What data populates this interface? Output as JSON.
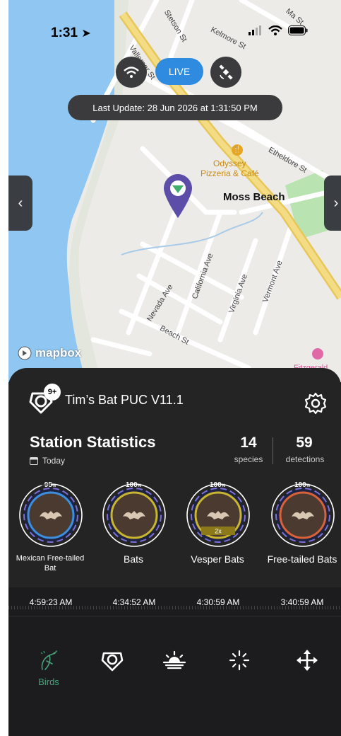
{
  "status_bar": {
    "time": "1:31"
  },
  "map": {
    "live_label": "LIVE",
    "last_update": "Last Update: 28 Jun 2026 at 1:31:50 PM",
    "place": "Moss Beach",
    "poi": {
      "line1": "Odyssey",
      "line2": "Pizzeria & Café"
    },
    "partial_label": "Fitzgerald",
    "streets": {
      "stetson": "Stetson St",
      "kelmore": "Kelmore St",
      "vallemar": "Vallemar St",
      "etheldore": "Etheldore St",
      "california": "California Ave",
      "nevada": "Nevada Ave",
      "virginia": "Virginia Ave",
      "vermont": "Vermont Ave",
      "beach": "Beach St",
      "top_right": "Ma St"
    },
    "attribution": "mapbox"
  },
  "station": {
    "name": "Tim’s Bat PUC V11.1",
    "badge": "9+",
    "stats_title": "Station Statistics",
    "period": "Today",
    "species_count": "14",
    "species_label": "species",
    "detections_count": "59",
    "detections_label": "detections"
  },
  "species": [
    {
      "name": "Mexican Free-tailed Bat",
      "confidence_label": "95",
      "confidence": 95,
      "time": "4:59:23 AM",
      "ring_color": "#3c8fde",
      "badge": ""
    },
    {
      "name": "Bats",
      "confidence_label": "100",
      "confidence": 100,
      "time": "4:34:52 AM",
      "ring_color": "#c9b530",
      "badge": ""
    },
    {
      "name": "Vesper Bats",
      "confidence_label": "100",
      "confidence": 100,
      "time": "4:30:59 AM",
      "ring_color": "#c9b530",
      "badge": "2x"
    },
    {
      "name": "Free-tailed Bats",
      "confidence_label": "100",
      "confidence": 100,
      "time": "3:40:59 AM",
      "ring_color": "#d9623a",
      "badge": ""
    }
  ],
  "nav": [
    {
      "label": "Birds",
      "icon": "bird-icon",
      "active": true
    },
    {
      "label": "",
      "icon": "station-icon",
      "active": false
    },
    {
      "label": "",
      "icon": "sunrise-icon",
      "active": false
    },
    {
      "label": "",
      "icon": "loading-icon",
      "active": false
    },
    {
      "label": "",
      "icon": "move-icon",
      "active": false
    }
  ],
  "colors": {
    "accent": "#2f8be0",
    "nav_active": "#49a07a",
    "panel": "#242424"
  }
}
